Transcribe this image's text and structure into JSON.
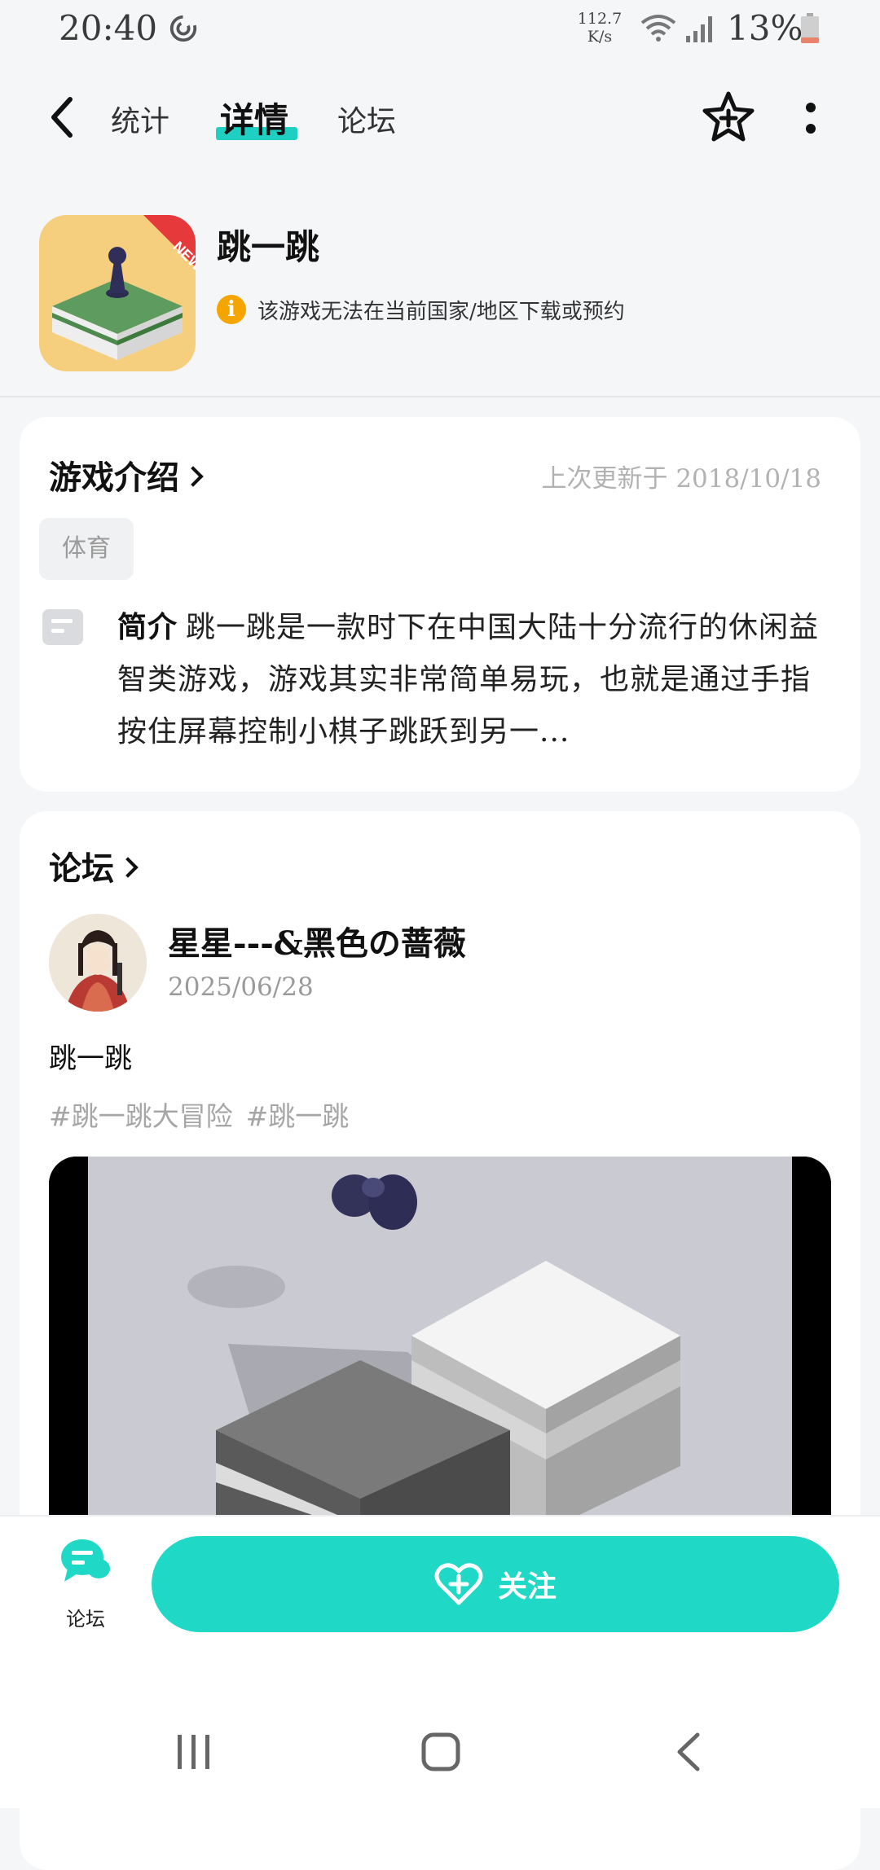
{
  "status_bar": {
    "time": "20:40",
    "net_speed_value": "112.7",
    "net_speed_unit": "K/s",
    "battery": "13%"
  },
  "nav": {
    "tabs": [
      {
        "label": "统计",
        "active": false
      },
      {
        "label": "详情",
        "active": true
      },
      {
        "label": "论坛",
        "active": false
      }
    ]
  },
  "app": {
    "name": "跳一跳",
    "icon_badge": "NEW",
    "notice_icon": "i",
    "notice": "该游戏无法在当前国家/地区下载或预约"
  },
  "intro": {
    "title": "游戏介绍",
    "updated": "上次更新于 2018/10/18",
    "tag": "体育",
    "desc_label": "简介",
    "desc_text": "跳一跳是一款时下在中国大陆十分流行的休闲益智类游戏，游戏其实非常简单易玩，也就是通过手指按住屏幕控制小棋子跳跃到另一..."
  },
  "forum": {
    "title": "论坛",
    "post": {
      "username": "星星---&黑色の蔷薇",
      "date": "2025/06/28",
      "title": "跳一跳",
      "hashtags": [
        "#跳一跳大冒险",
        "#跳一跳"
      ]
    }
  },
  "bottom_bar": {
    "forum_label": "论坛",
    "follow_label": "关注"
  },
  "colors": {
    "accent": "#1fd8c6",
    "background": "#f5f6f8",
    "warning": "#f5a500"
  }
}
